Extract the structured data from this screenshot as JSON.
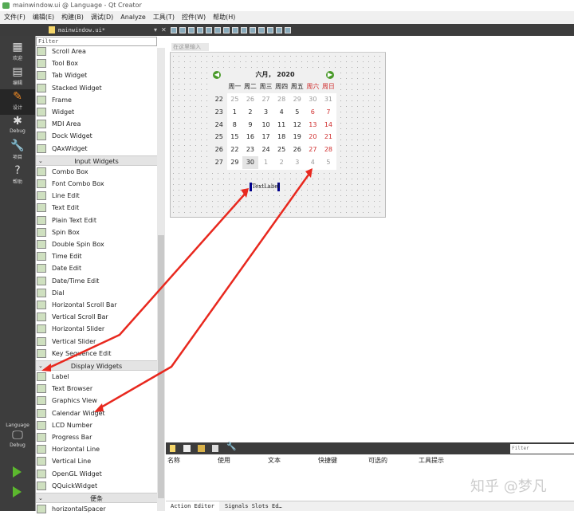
{
  "window": {
    "title": "mainwindow.ui @ Language - Qt Creator"
  },
  "menu": [
    "文件(F)",
    "编辑(E)",
    "构建(B)",
    "调试(D)",
    "Analyze",
    "工具(T)",
    "控件(W)",
    "帮助(H)"
  ],
  "editor": {
    "file_tab": "mainwindow.ui*"
  },
  "modes": [
    {
      "label": "欢迎",
      "icon": "grid-icon"
    },
    {
      "label": "编辑",
      "icon": "document-icon"
    },
    {
      "label": "设计",
      "icon": "pencil-icon"
    },
    {
      "label": "Debug",
      "icon": "bug-icon"
    },
    {
      "label": "项目",
      "icon": "wrench-icon"
    },
    {
      "label": "帮助",
      "icon": "help-icon"
    }
  ],
  "kit": {
    "project": "Language",
    "config": "Debug"
  },
  "widget_box": {
    "filter_placeholder": "Filter",
    "containers": [
      "Scroll Area",
      "Tool Box",
      "Tab Widget",
      "Stacked Widget",
      "Frame",
      "Widget",
      "MDI Area",
      "Dock Widget",
      "QAxWidget"
    ],
    "input_header": "Input Widgets",
    "input": [
      "Combo Box",
      "Font Combo Box",
      "Line Edit",
      "Text Edit",
      "Plain Text Edit",
      "Spin Box",
      "Double Spin Box",
      "Time Edit",
      "Date Edit",
      "Date/Time Edit",
      "Dial",
      "Horizontal Scroll Bar",
      "Vertical Scroll Bar",
      "Horizontal Slider",
      "Vertical Slider",
      "Key Sequence Edit"
    ],
    "display_header": "Display Widgets",
    "display": [
      "Label",
      "Text Browser",
      "Graphics View",
      "Calendar Widget",
      "LCD Number",
      "Progress Bar",
      "Horizontal Line",
      "Vertical Line",
      "OpenGL Widget",
      "QQuickWidget"
    ],
    "notes_header": "便条",
    "notes": [
      "horizontalSpacer"
    ]
  },
  "form": {
    "menu_placeholder": "在这里输入",
    "calendar": {
      "month_year": "六月， 2020",
      "weekdays": [
        "周一",
        "周二",
        "周三",
        "周四",
        "周五",
        "周六",
        "周日"
      ],
      "weeks": [
        [
          "22",
          "25",
          "26",
          "27",
          "28",
          "29",
          "30",
          "31"
        ],
        [
          "23",
          "1",
          "2",
          "3",
          "4",
          "5",
          "6",
          "7"
        ],
        [
          "24",
          "8",
          "9",
          "10",
          "11",
          "12",
          "13",
          "14"
        ],
        [
          "25",
          "15",
          "16",
          "17",
          "18",
          "19",
          "20",
          "21"
        ],
        [
          "26",
          "22",
          "23",
          "24",
          "25",
          "26",
          "27",
          "28"
        ],
        [
          "27",
          "29",
          "30",
          "1",
          "2",
          "3",
          "4",
          "5"
        ]
      ],
      "selected": "30"
    },
    "label_text": "TextLabel"
  },
  "action_editor": {
    "filter_placeholder": "Filter",
    "columns": [
      "名称",
      "使用",
      "文本",
      "快捷键",
      "可选的",
      "工具提示"
    ],
    "tabs": [
      "Action Editor",
      "Signals Slots Ed…"
    ]
  },
  "watermark": "知乎 @梦凡",
  "colors": {
    "weekend": "#d03030",
    "accent": "#f08a24",
    "arrow": "#e8281e",
    "selection": "#00008b"
  }
}
